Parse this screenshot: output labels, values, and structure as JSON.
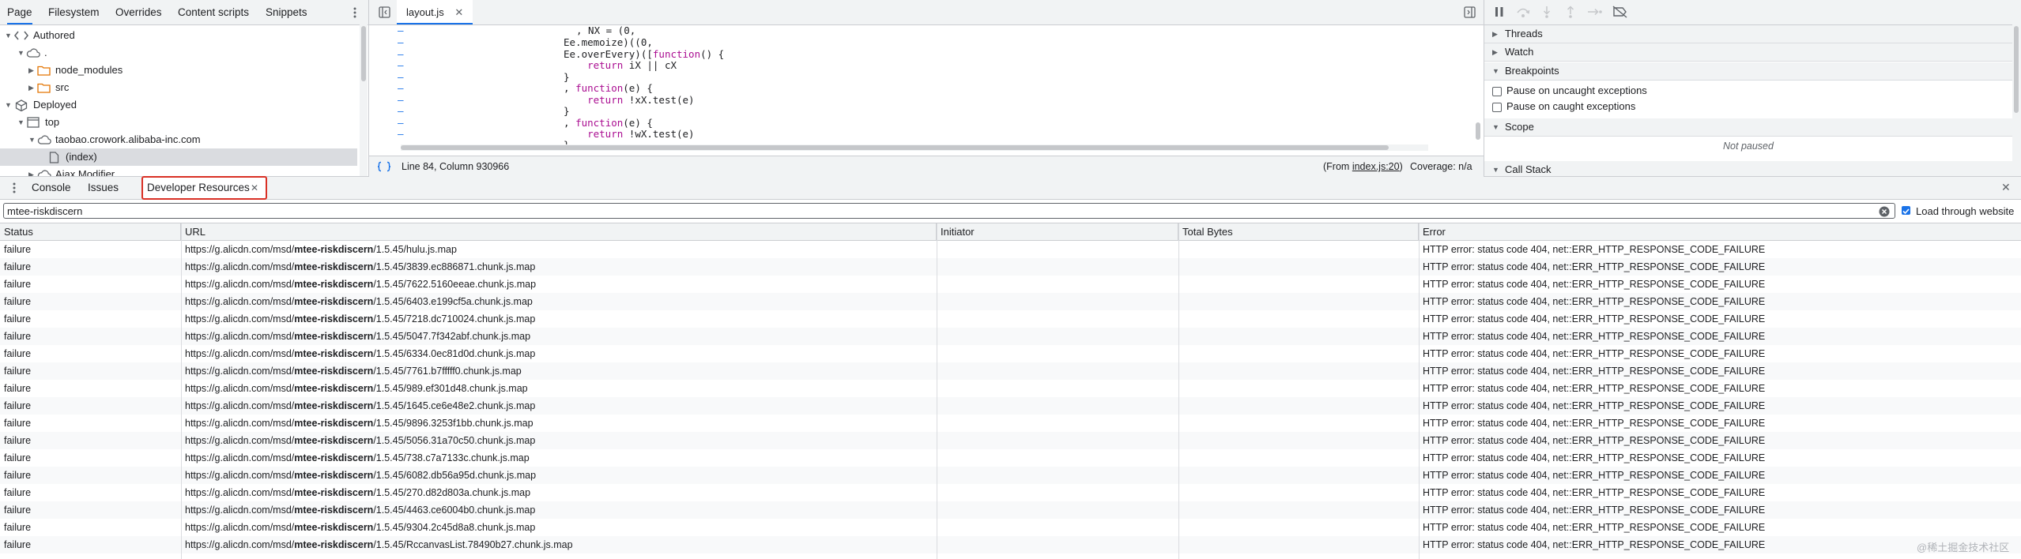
{
  "navigator": {
    "tabs": [
      "Page",
      "Filesystem",
      "Overrides",
      "Content scripts",
      "Snippets"
    ],
    "tree": [
      {
        "label": "Authored",
        "icon": "code-brackets-icon"
      },
      {
        "label": ".",
        "icon": "cloud-icon"
      },
      {
        "label": "node_modules",
        "icon": "folder-icon"
      },
      {
        "label": "src",
        "icon": "folder-icon"
      },
      {
        "label": "Deployed",
        "icon": "cube-icon"
      },
      {
        "label": "top",
        "icon": "frame-icon"
      },
      {
        "label": "taobao.crowork.alibaba-inc.com",
        "icon": "cloud-icon"
      },
      {
        "label": "(index)",
        "icon": "file-icon"
      },
      {
        "label": "Ajax Modifier",
        "icon": "cloud-icon"
      }
    ]
  },
  "editor": {
    "file_tab": "layout.js",
    "code_lines": [
      ", NX = (0,",
      "Ee.memoize)((0,",
      "Ee.overEvery)([function() {",
      "    return iX || cX",
      "}",
      ", function(e) {",
      "    return !xX.test(e)",
      "}",
      ", function(e) {",
      "    return !wX.test(e)",
      "}"
    ],
    "status_position": "Line 84, Column 930966",
    "status_from_prefix": "(From ",
    "status_from_link": "index.js:20",
    "status_from_suffix": ")",
    "status_coverage": "Coverage: n/a"
  },
  "debugger": {
    "sections": {
      "threads": "Threads",
      "watch": "Watch",
      "breakpoints": "Breakpoints",
      "scope": "Scope",
      "call_stack": "Call Stack"
    },
    "pause_uncaught": "Pause on uncaught exceptions",
    "pause_caught": "Pause on caught exceptions",
    "not_paused": "Not paused"
  },
  "drawer": {
    "tabs": {
      "console": "Console",
      "issues": "Issues",
      "developer_resources": "Developer Resources"
    },
    "filter_value": "mtee-riskdiscern",
    "load_through_website": "Load through website",
    "columns": [
      "Status",
      "URL",
      "Initiator",
      "Total Bytes",
      "Error"
    ],
    "rows": [
      {
        "status": "failure",
        "url_prefix": "https://g.alicdn.com/msd/",
        "url_match": "mtee-riskdiscern",
        "url_suffix": "/1.5.45/hulu.js.map",
        "error": "HTTP error: status code 404, net::ERR_HTTP_RESPONSE_CODE_FAILURE"
      },
      {
        "status": "failure",
        "url_prefix": "https://g.alicdn.com/msd/",
        "url_match": "mtee-riskdiscern",
        "url_suffix": "/1.5.45/3839.ec886871.chunk.js.map",
        "error": "HTTP error: status code 404, net::ERR_HTTP_RESPONSE_CODE_FAILURE"
      },
      {
        "status": "failure",
        "url_prefix": "https://g.alicdn.com/msd/",
        "url_match": "mtee-riskdiscern",
        "url_suffix": "/1.5.45/7622.5160eeae.chunk.js.map",
        "error": "HTTP error: status code 404, net::ERR_HTTP_RESPONSE_CODE_FAILURE"
      },
      {
        "status": "failure",
        "url_prefix": "https://g.alicdn.com/msd/",
        "url_match": "mtee-riskdiscern",
        "url_suffix": "/1.5.45/6403.e199cf5a.chunk.js.map",
        "error": "HTTP error: status code 404, net::ERR_HTTP_RESPONSE_CODE_FAILURE"
      },
      {
        "status": "failure",
        "url_prefix": "https://g.alicdn.com/msd/",
        "url_match": "mtee-riskdiscern",
        "url_suffix": "/1.5.45/7218.dc710024.chunk.js.map",
        "error": "HTTP error: status code 404, net::ERR_HTTP_RESPONSE_CODE_FAILURE"
      },
      {
        "status": "failure",
        "url_prefix": "https://g.alicdn.com/msd/",
        "url_match": "mtee-riskdiscern",
        "url_suffix": "/1.5.45/5047.7f342abf.chunk.js.map",
        "error": "HTTP error: status code 404, net::ERR_HTTP_RESPONSE_CODE_FAILURE"
      },
      {
        "status": "failure",
        "url_prefix": "https://g.alicdn.com/msd/",
        "url_match": "mtee-riskdiscern",
        "url_suffix": "/1.5.45/6334.0ec81d0d.chunk.js.map",
        "error": "HTTP error: status code 404, net::ERR_HTTP_RESPONSE_CODE_FAILURE"
      },
      {
        "status": "failure",
        "url_prefix": "https://g.alicdn.com/msd/",
        "url_match": "mtee-riskdiscern",
        "url_suffix": "/1.5.45/7761.b7fffff0.chunk.js.map",
        "error": "HTTP error: status code 404, net::ERR_HTTP_RESPONSE_CODE_FAILURE"
      },
      {
        "status": "failure",
        "url_prefix": "https://g.alicdn.com/msd/",
        "url_match": "mtee-riskdiscern",
        "url_suffix": "/1.5.45/989.ef301d48.chunk.js.map",
        "error": "HTTP error: status code 404, net::ERR_HTTP_RESPONSE_CODE_FAILURE"
      },
      {
        "status": "failure",
        "url_prefix": "https://g.alicdn.com/msd/",
        "url_match": "mtee-riskdiscern",
        "url_suffix": "/1.5.45/1645.ce6e48e2.chunk.js.map",
        "error": "HTTP error: status code 404, net::ERR_HTTP_RESPONSE_CODE_FAILURE"
      },
      {
        "status": "failure",
        "url_prefix": "https://g.alicdn.com/msd/",
        "url_match": "mtee-riskdiscern",
        "url_suffix": "/1.5.45/9896.3253f1bb.chunk.js.map",
        "error": "HTTP error: status code 404, net::ERR_HTTP_RESPONSE_CODE_FAILURE"
      },
      {
        "status": "failure",
        "url_prefix": "https://g.alicdn.com/msd/",
        "url_match": "mtee-riskdiscern",
        "url_suffix": "/1.5.45/5056.31a70c50.chunk.js.map",
        "error": "HTTP error: status code 404, net::ERR_HTTP_RESPONSE_CODE_FAILURE"
      },
      {
        "status": "failure",
        "url_prefix": "https://g.alicdn.com/msd/",
        "url_match": "mtee-riskdiscern",
        "url_suffix": "/1.5.45/738.c7a7133c.chunk.js.map",
        "error": "HTTP error: status code 404, net::ERR_HTTP_RESPONSE_CODE_FAILURE"
      },
      {
        "status": "failure",
        "url_prefix": "https://g.alicdn.com/msd/",
        "url_match": "mtee-riskdiscern",
        "url_suffix": "/1.5.45/6082.db56a95d.chunk.js.map",
        "error": "HTTP error: status code 404, net::ERR_HTTP_RESPONSE_CODE_FAILURE"
      },
      {
        "status": "failure",
        "url_prefix": "https://g.alicdn.com/msd/",
        "url_match": "mtee-riskdiscern",
        "url_suffix": "/1.5.45/270.d82d803a.chunk.js.map",
        "error": "HTTP error: status code 404, net::ERR_HTTP_RESPONSE_CODE_FAILURE"
      },
      {
        "status": "failure",
        "url_prefix": "https://g.alicdn.com/msd/",
        "url_match": "mtee-riskdiscern",
        "url_suffix": "/1.5.45/4463.ce6004b0.chunk.js.map",
        "error": "HTTP error: status code 404, net::ERR_HTTP_RESPONSE_CODE_FAILURE"
      },
      {
        "status": "failure",
        "url_prefix": "https://g.alicdn.com/msd/",
        "url_match": "mtee-riskdiscern",
        "url_suffix": "/1.5.45/9304.2c45d8a8.chunk.js.map",
        "error": "HTTP error: status code 404, net::ERR_HTTP_RESPONSE_CODE_FAILURE"
      },
      {
        "status": "failure",
        "url_prefix": "https://g.alicdn.com/msd/",
        "url_match": "mtee-riskdiscern",
        "url_suffix": "/1.5.45/RccanvasList.78490b27.chunk.js.map",
        "error": "HTTP error: status code 404, net::ERR_HTTP_RESPONSE_CODE_FAILURE"
      }
    ]
  },
  "watermark": "@稀土掘金技术社区",
  "colors": {
    "accent": "#1a73e8",
    "highlight_border": "#d93025",
    "toolbar_bg": "#f1f3f4",
    "selected_bg": "#dadce0",
    "keyword": "#aa0d91"
  }
}
